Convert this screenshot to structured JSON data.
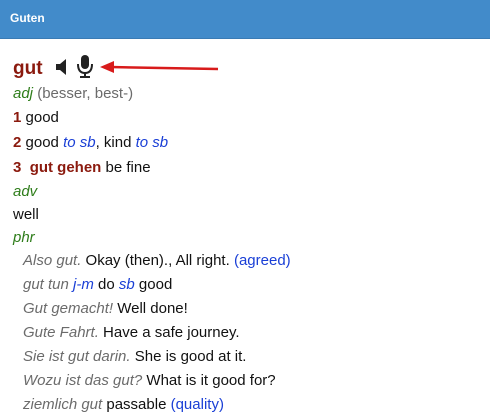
{
  "window": {
    "title": "Guten"
  },
  "entry": {
    "headword": "gut",
    "icons": [
      "speaker-icon",
      "microphone-icon"
    ],
    "adj_label": "adj",
    "adj_forms": "(besser, best-)",
    "senses": [
      {
        "num": "1",
        "text": "good"
      },
      {
        "num": "2",
        "text_a": "good",
        "to_sb_1": "to sb",
        "text_b": ", kind",
        "to_sb_2": "to sb"
      },
      {
        "num": "3",
        "phrase": "gut gehen",
        "text": "be fine"
      }
    ],
    "adv_label": "adv",
    "adv_text": "well",
    "phr_label": "phr",
    "phrases": [
      {
        "de": "Also gut.",
        "en": "Okay (then)., All right.",
        "note": "(agreed)"
      },
      {
        "de_a": "gut tun",
        "de_b": "j-m",
        "en_a": "do",
        "en_b": "sb",
        "en_c": "good"
      },
      {
        "de": "Gut gemacht!",
        "en": "Well done!"
      },
      {
        "de": "Gute Fahrt.",
        "en": "Have a safe journey."
      },
      {
        "de": "Sie ist gut darin.",
        "en": "She is good at it."
      },
      {
        "de": "Wozu ist das gut?",
        "en": "What is it good for?"
      },
      {
        "de": "ziemlich gut",
        "en": "passable",
        "note": "(quality)"
      }
    ]
  },
  "colors": {
    "titlebar": "#428bca",
    "headword": "#8b1a0e",
    "pos": "#2e7d1a",
    "link": "#1a3fd6",
    "arrow": "#d81b1b"
  }
}
